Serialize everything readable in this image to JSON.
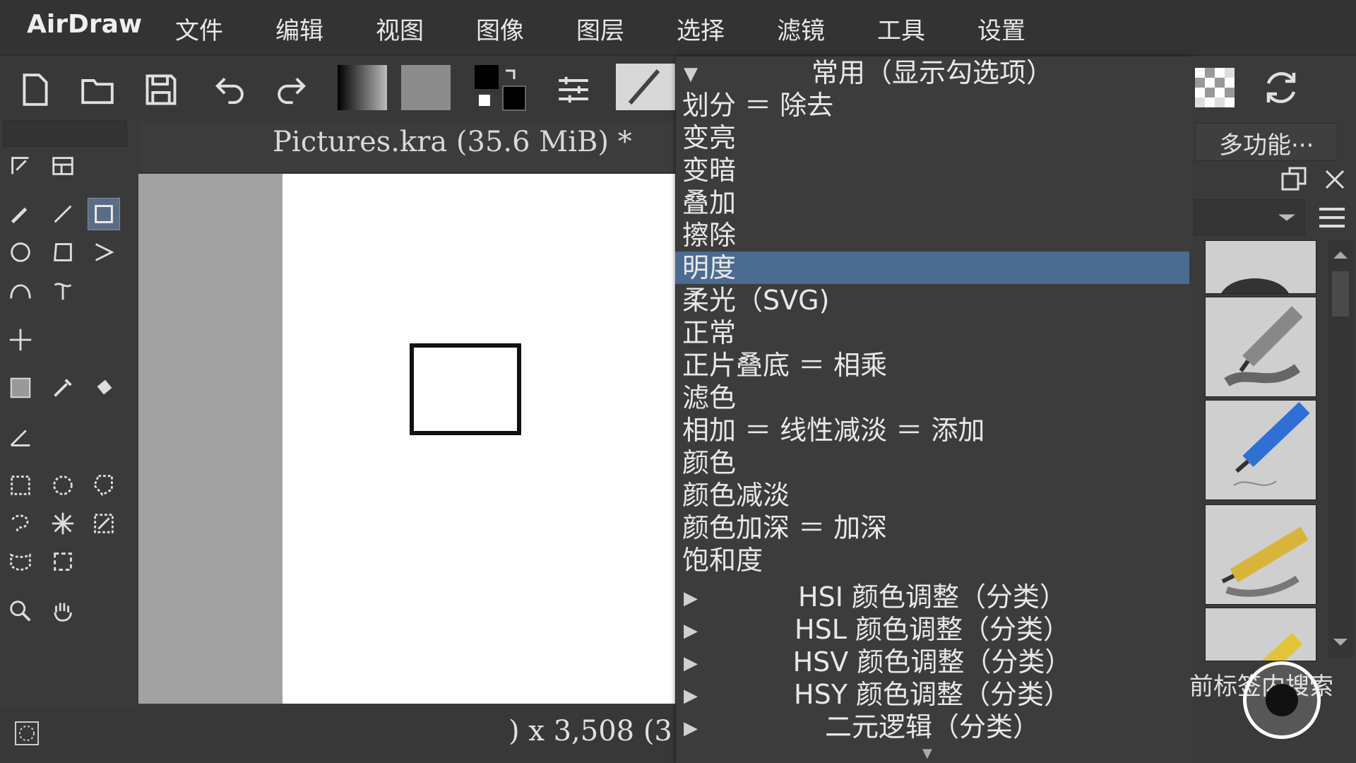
{
  "menubar": {
    "app_title": "AirDraw",
    "items": [
      "文件",
      "编辑",
      "视图",
      "图像",
      "图层",
      "选择",
      "滤镜",
      "工具",
      "设置"
    ]
  },
  "toolbar": {
    "icons": [
      "new-document-icon",
      "open-folder-icon",
      "save-icon",
      "undo-icon",
      "redo-icon",
      "gradient-icon",
      "pattern-icon",
      "swap-colors-icon",
      "brush-settings-icon",
      "brush-preset-icon"
    ]
  },
  "document": {
    "title": "Pictures.kra (35.6 MiB) *"
  },
  "status": {
    "dimensions_text": ") x 3,508 (3"
  },
  "blend_dropdown": {
    "header": "常用（显示勾选项）",
    "items": [
      {
        "label": "划分 ＝ 除去",
        "selected": false
      },
      {
        "label": "变亮",
        "selected": false
      },
      {
        "label": "变暗",
        "selected": false
      },
      {
        "label": "叠加",
        "selected": false
      },
      {
        "label": "擦除",
        "selected": false
      },
      {
        "label": "明度",
        "selected": true
      },
      {
        "label": "柔光（SVG)",
        "selected": false
      },
      {
        "label": "正常",
        "selected": false
      },
      {
        "label": "正片叠底 ＝ 相乘",
        "selected": false
      },
      {
        "label": "滤色",
        "selected": false
      },
      {
        "label": "相加 ＝ 线性减淡 ＝ 添加",
        "selected": false
      },
      {
        "label": "颜色",
        "selected": false
      },
      {
        "label": "颜色减淡",
        "selected": false
      },
      {
        "label": "颜色加深 ＝ 加深",
        "selected": false
      },
      {
        "label": "饱和度",
        "selected": false
      }
    ],
    "groups": [
      "HSI 颜色调整（分类）",
      "HSL 颜色调整（分类）",
      "HSV 颜色调整（分类）",
      "HSY 颜色调整（分类）",
      "二元逻辑（分类）"
    ]
  },
  "right_panel": {
    "multi_label": "多功能···",
    "search_label": "前标签内搜索"
  },
  "colors": {
    "selection": "#4b6b91",
    "active_tool": "#5b6d84"
  }
}
